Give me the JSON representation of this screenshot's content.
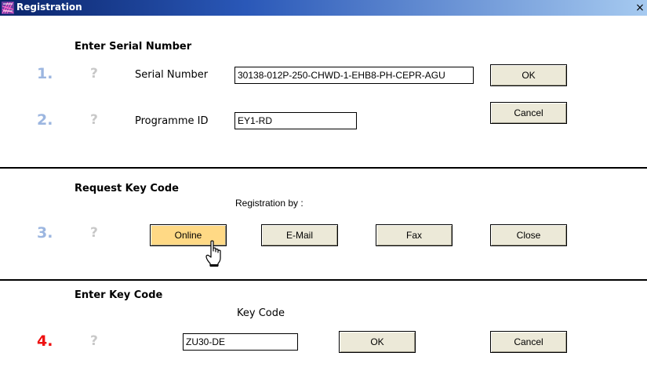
{
  "window": {
    "title": "Registration",
    "close_glyph": "×"
  },
  "colors": {
    "step_number": "#9cb6e0",
    "step_number_highlight": "#ee1111",
    "online_button": "#ffd985"
  },
  "section_serial": {
    "heading": "Enter Serial Number",
    "step1": {
      "number": "1.",
      "help": "?",
      "label": "Serial Number",
      "value": "30138-012P-250-CHWD-1-EHB8-PH-CEPR-AGU"
    },
    "step2": {
      "number": "2.",
      "help": "?",
      "label": "Programme ID",
      "value": "EY1-RD"
    },
    "ok_label": "OK",
    "cancel_label": "Cancel"
  },
  "section_request": {
    "heading": "Request Key Code",
    "subheading": "Registration by :",
    "step3": {
      "number": "3.",
      "help": "?"
    },
    "online_label": "Online",
    "email_label": "E-Mail",
    "fax_label": "Fax",
    "close_label": "Close"
  },
  "section_keycode": {
    "heading": "Enter Key Code",
    "field_label": "Key Code",
    "step4": {
      "number": "4.",
      "help": "?",
      "value": "ZU30-DE"
    },
    "ok_label": "OK",
    "cancel_label": "Cancel"
  },
  "icons": {
    "app": "registration-app-icon",
    "cursor": "hand-pointer-icon"
  }
}
